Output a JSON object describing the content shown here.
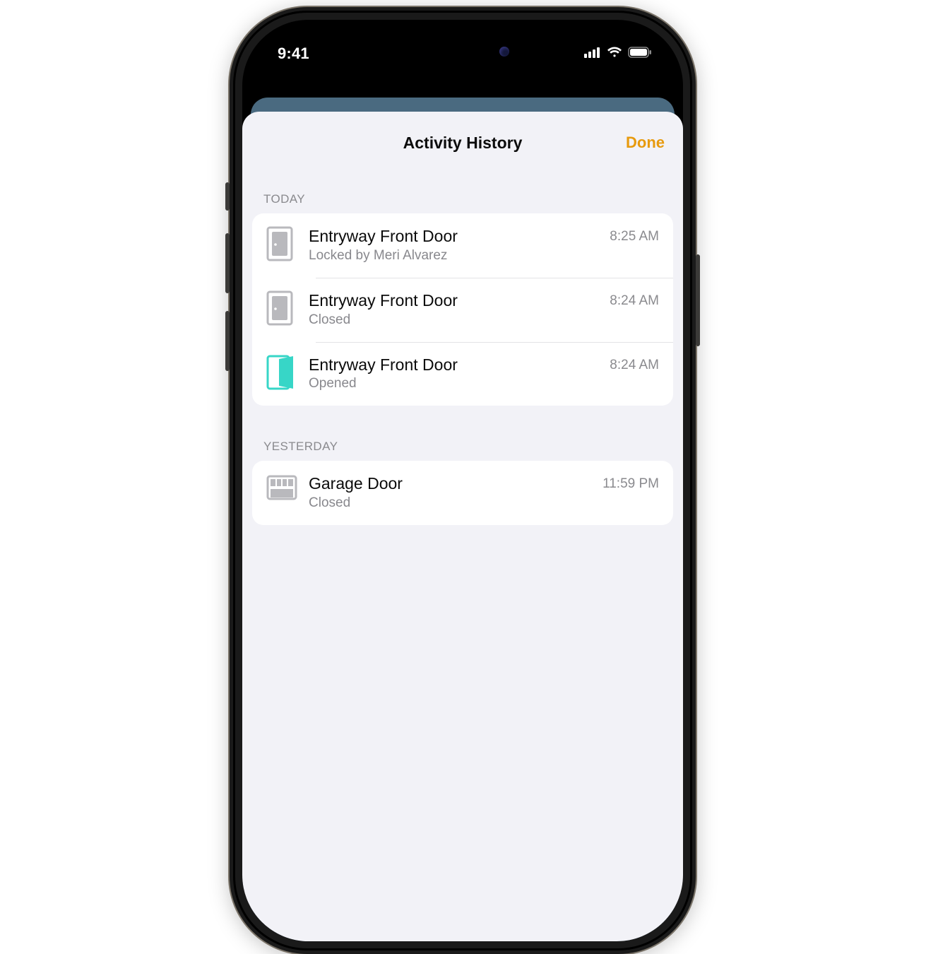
{
  "statusbar": {
    "time": "9:41"
  },
  "sheet": {
    "title": "Activity History",
    "done_label": "Done"
  },
  "sections": [
    {
      "label": "Today",
      "rows": [
        {
          "icon": "door-closed",
          "title": "Entryway Front Door",
          "subtitle": "Locked by Meri Alvarez",
          "time": "8:25 AM"
        },
        {
          "icon": "door-closed",
          "title": "Entryway Front Door",
          "subtitle": "Closed",
          "time": "8:24 AM"
        },
        {
          "icon": "door-open",
          "title": "Entryway Front Door",
          "subtitle": "Opened",
          "time": "8:24 AM"
        }
      ]
    },
    {
      "label": "Yesterday",
      "rows": [
        {
          "icon": "garage-closed",
          "title": "Garage Door",
          "subtitle": "Closed",
          "time": "11:59 PM"
        }
      ]
    }
  ]
}
